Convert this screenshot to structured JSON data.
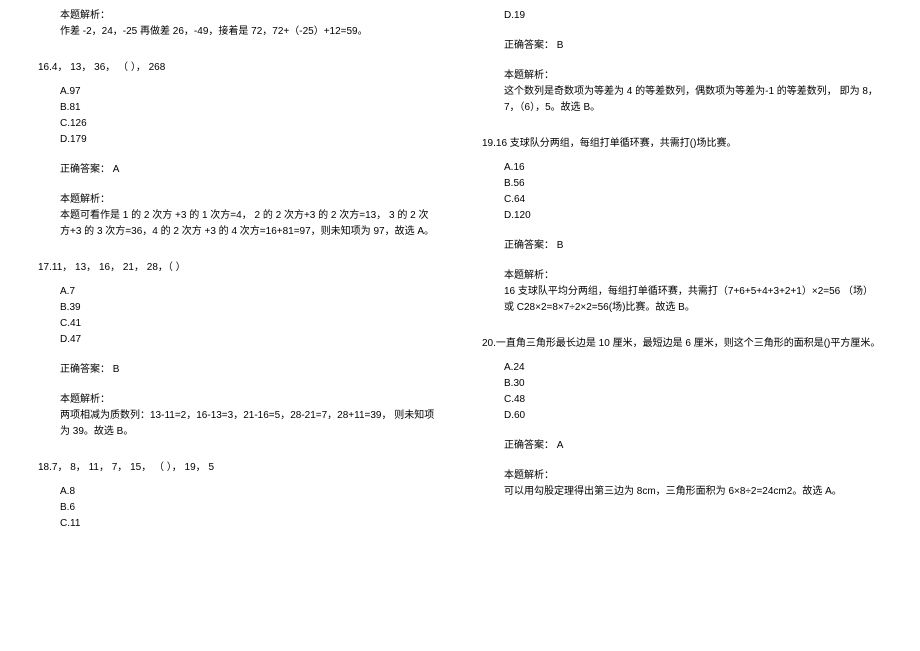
{
  "left": {
    "q15": {
      "parse_label": "本题解析：",
      "parse_body": "作差 -2，24，-25 再做差 26，-49，接着是 72，72+（-25）+12=59。"
    },
    "q16": {
      "stem": "16.4， 13， 36， （ ）， 268",
      "opts": {
        "a": "A.97",
        "b": "B.81",
        "c": "C.126",
        "d": "D.179"
      },
      "answer": "正确答案： A",
      "parse_label": "本题解析：",
      "parse_body": "本题可看作是 1 的 2 次方 +3 的 1 次方=4， 2 的 2 次方+3 的 2 次方=13， 3 的 2 次方+3 的 3 次方=36，4 的 2 次方 +3 的 4 次方=16+81=97，则未知项为 97，故选 A。"
    },
    "q17": {
      "stem": "17.11， 13， 16， 21， 28，（ ）",
      "opts": {
        "a": "A.7",
        "b": "B.39",
        "c": "C.41",
        "d": "D.47"
      },
      "answer": "正确答案： B",
      "parse_label": "本题解析：",
      "parse_body": "两项相减为质数列：13-11=2，16-13=3，21-16=5，28-21=7，28+11=39， 则未知项为 39。故选 B。"
    },
    "q18": {
      "stem": "18.7， 8， 11， 7， 15， （ ）， 19， 5",
      "opts": {
        "a": "A.8",
        "b": "B.6",
        "c": "C.11"
      }
    }
  },
  "right": {
    "q18": {
      "d": "D.19",
      "answer": "正确答案： B",
      "parse_label": "本题解析：",
      "parse_body": "这个数列是奇数项为等差为 4 的等差数列，偶数项为等差为-1 的等差数列， 即为 8，7，（6），5。故选 B。"
    },
    "q19": {
      "stem": "19.16 支球队分两组，每组打单循环赛，共需打()场比赛。",
      "opts": {
        "a": "A.16",
        "b": "B.56",
        "c": "C.64",
        "d": "D.120"
      },
      "answer": "正确答案： B",
      "parse_label": "本题解析：",
      "parse_body": "16 支球队平均分两组，每组打单循环赛，共需打（7+6+5+4+3+2+1）×2=56 （场）或 C28×2=8×7÷2×2=56(场)比赛。故选 B。"
    },
    "q20": {
      "stem": "20.一直角三角形最长边是 10 厘米，最短边是 6 厘米，则这个三角形的面积是()平方厘米。",
      "opts": {
        "a": "A.24",
        "b": "B.30",
        "c": "C.48",
        "d": "D.60"
      },
      "answer": "正确答案： A",
      "parse_label": "本题解析：",
      "parse_body": "可以用勾股定理得出第三边为 8cm，三角形面积为 6×8÷2=24cm2。故选 A。"
    }
  }
}
